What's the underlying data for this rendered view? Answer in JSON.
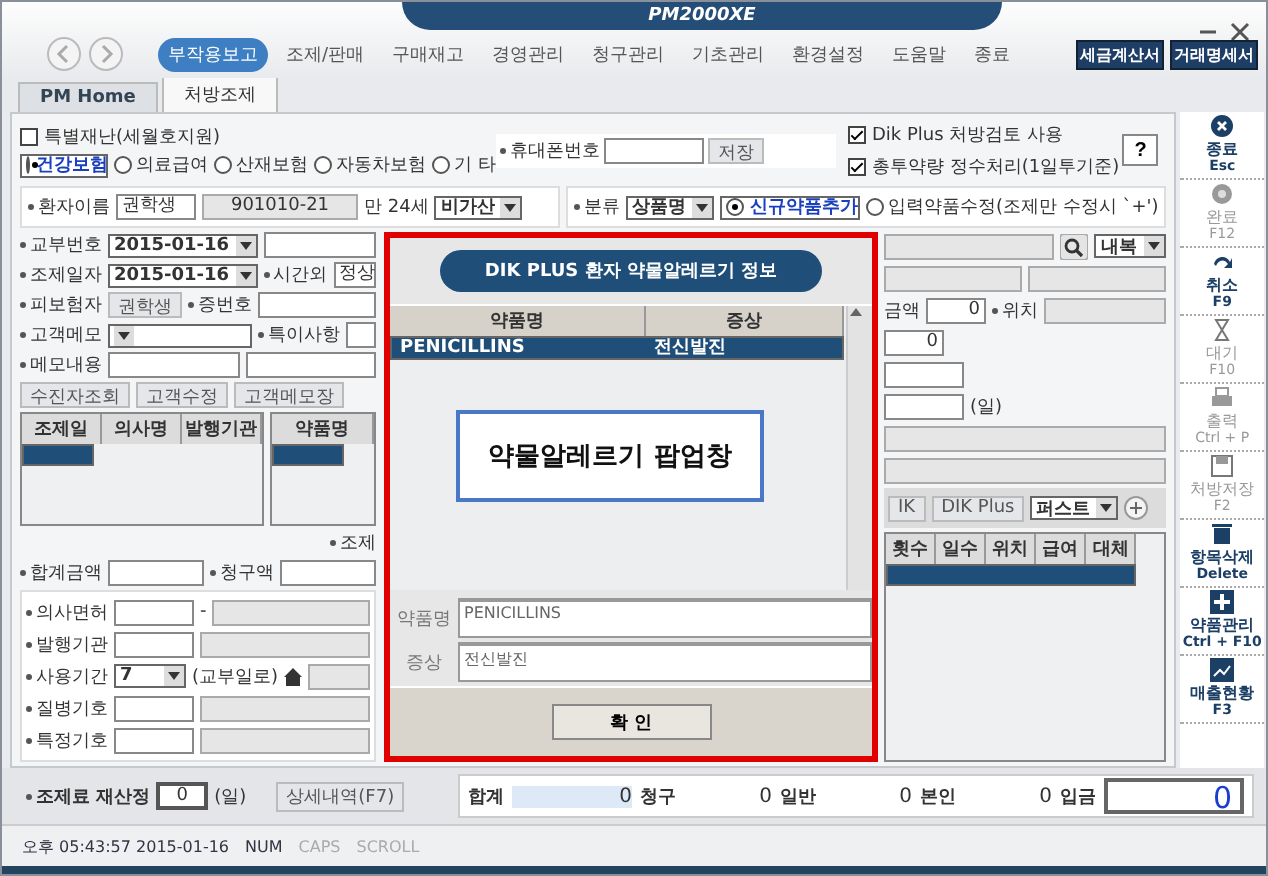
{
  "window": {
    "title": "PM2000XE"
  },
  "menu": [
    {
      "label": "부작용보고",
      "selected": true
    },
    {
      "label": "조제/판매",
      "selected": false
    },
    {
      "label": "구매재고",
      "selected": false
    },
    {
      "label": "경영관리",
      "selected": false
    },
    {
      "label": "청구관리",
      "selected": false
    },
    {
      "label": "기초관리",
      "selected": false
    },
    {
      "label": "환경설정",
      "selected": false
    },
    {
      "label": "도움말",
      "selected": false
    },
    {
      "label": "종료",
      "selected": false
    }
  ],
  "header_buttons": [
    "세금계산서",
    "거래명세서"
  ],
  "tabs": [
    {
      "label": "PM Home",
      "selected": false
    },
    {
      "label": "처방조제",
      "selected": true
    }
  ],
  "special_disaster": {
    "label": "특별재난(세월호지원)",
    "checked": false
  },
  "insurance_types": [
    {
      "label": "건강보험",
      "selected": true
    },
    {
      "label": "의료급여",
      "selected": false
    },
    {
      "label": "산재보험",
      "selected": false
    },
    {
      "label": "자동차보험",
      "selected": false
    },
    {
      "label": "기 타",
      "selected": false
    }
  ],
  "phone": {
    "label": "휴대폰번호",
    "save": "저장"
  },
  "options": [
    {
      "label": "Dik Plus 처방검토 사용",
      "checked": true
    },
    {
      "label": "총투약량 정수처리(1일투기준)",
      "checked": true
    }
  ],
  "help": "?",
  "patient_row": [
    {
      "kind": "label",
      "text": "환자이름"
    },
    {
      "kind": "box",
      "value": "권학생"
    },
    {
      "kind": "field",
      "value": "901010-21"
    },
    {
      "kind": "text",
      "text": "만 24세"
    },
    {
      "kind": "select",
      "value": "비가산"
    }
  ],
  "classify_row": [
    {
      "kind": "label",
      "text": "분류"
    },
    {
      "kind": "select",
      "value": "상품명"
    },
    {
      "kind": "radio",
      "text": "신규약품추가",
      "selected": true
    },
    {
      "kind": "radio",
      "text": "입력약품수정(조제만 수정시 `+')",
      "selected": false
    }
  ],
  "left_rows": [
    [
      {
        "kind": "label",
        "text": "교부번호"
      },
      {
        "kind": "select",
        "value": "2015-01-16"
      },
      {
        "kind": "field"
      }
    ],
    [
      {
        "kind": "label",
        "text": "조제일자"
      },
      {
        "kind": "select",
        "value": "2015-01-16"
      },
      {
        "kind": "label",
        "text": "시간외"
      },
      {
        "kind": "field",
        "value": "정상"
      }
    ],
    [
      {
        "kind": "label",
        "text": "피보험자"
      },
      {
        "kind": "button",
        "text": "권학생"
      },
      {
        "kind": "label",
        "text": "증번호"
      },
      {
        "kind": "field"
      }
    ],
    [
      {
        "kind": "label",
        "text": "고객메모"
      },
      {
        "kind": "select"
      },
      {
        "kind": "label",
        "text": "특이사항"
      },
      {
        "kind": "field"
      }
    ],
    [
      {
        "kind": "label",
        "text": "메모내용"
      },
      {
        "kind": "field"
      },
      {
        "kind": "field"
      }
    ],
    [
      {
        "kind": "button",
        "text": "수진자조회"
      },
      {
        "kind": "button",
        "text": "고객수정"
      },
      {
        "kind": "button",
        "text": "고객메모장"
      }
    ]
  ],
  "history_table": {
    "columns": [
      "조제일",
      "의사명",
      "발행기관"
    ],
    "rows": [
      {
        "selected": true
      }
    ]
  },
  "drug_table": {
    "columns": [
      "약품명"
    ],
    "rows": [
      {
        "selected": true
      }
    ]
  },
  "sum_rows": [
    [
      {
        "kind": "label",
        "text": "조제"
      }
    ],
    [
      {
        "kind": "label",
        "text": "합계금액"
      },
      {
        "kind": "field"
      },
      {
        "kind": "label",
        "text": "청구액"
      },
      {
        "kind": "field"
      }
    ]
  ],
  "doctor_rows": [
    [
      {
        "kind": "label",
        "text": "의사면허"
      },
      {
        "kind": "box"
      },
      {
        "kind": "text",
        "text": "-"
      },
      {
        "kind": "field"
      }
    ],
    [
      {
        "kind": "label",
        "text": "발행기관"
      },
      {
        "kind": "box"
      },
      {
        "kind": "field"
      }
    ],
    [
      {
        "kind": "label",
        "text": "사용기간"
      },
      {
        "kind": "select",
        "value": "7"
      },
      {
        "kind": "text",
        "text": "(교부일로)"
      },
      {
        "kind": "icon"
      },
      {
        "kind": "field"
      }
    ],
    [
      {
        "kind": "label",
        "text": "질병기호"
      },
      {
        "kind": "box"
      },
      {
        "kind": "field"
      }
    ],
    [
      {
        "kind": "label",
        "text": "특정기호"
      },
      {
        "kind": "box"
      },
      {
        "kind": "field"
      }
    ]
  ],
  "right_rows": [
    [
      {
        "kind": "field"
      },
      {
        "kind": "search"
      },
      {
        "kind": "select",
        "value": "내복"
      }
    ],
    [
      {
        "kind": "field"
      },
      {
        "kind": "field"
      }
    ],
    [
      {
        "kind": "text",
        "text": "금액"
      },
      {
        "kind": "number",
        "value": "0"
      },
      {
        "kind": "label",
        "text": "위치"
      },
      {
        "kind": "field"
      }
    ],
    [
      {
        "kind": "number",
        "value": "0"
      }
    ],
    [
      {
        "kind": "box"
      }
    ],
    [
      {
        "kind": "box"
      },
      {
        "kind": "text",
        "text": "(일)"
      }
    ],
    [
      {
        "kind": "field"
      }
    ],
    [
      {
        "kind": "field"
      }
    ],
    [
      {
        "kind": "button",
        "text": "IK"
      },
      {
        "kind": "button",
        "text": "DIK Plus"
      },
      {
        "kind": "select",
        "value": "퍼스트"
      },
      {
        "kind": "plus"
      }
    ]
  ],
  "rx_table": {
    "columns": [
      "횟수",
      "일수",
      "위치",
      "급여",
      "대체"
    ],
    "rows": [
      {
        "selected": true
      }
    ]
  },
  "popup": {
    "title": "DIK PLUS 환자 약물알레르기 정보",
    "columns": [
      "약품명",
      "증상"
    ],
    "rows": [
      {
        "cells": [
          "PENICILLINS",
          "전신발진"
        ],
        "selected": true
      }
    ],
    "note": "약물알레르기 팝업창",
    "details": [
      {
        "label": "약품명",
        "value": "PENICILLINS"
      },
      {
        "label": "증상",
        "value": "전신발진"
      }
    ],
    "confirm": "확 인"
  },
  "sidebar": [
    {
      "kind": "close",
      "label": "종료",
      "key": "Esc",
      "disabled": false
    },
    {
      "kind": "done",
      "label": "완료",
      "key": "F12",
      "disabled": true
    },
    {
      "kind": "undo",
      "label": "취소",
      "key": "F9",
      "disabled": false
    },
    {
      "kind": "wait",
      "label": "대기",
      "key": "F10",
      "disabled": true
    },
    {
      "kind": "print",
      "label": "출력",
      "key": "Ctrl + P",
      "disabled": true
    },
    {
      "kind": "save",
      "label": "처방저장",
      "key": "F2",
      "disabled": true
    },
    {
      "kind": "delete",
      "label": "항목삭제",
      "key": "Delete",
      "disabled": false
    },
    {
      "kind": "add",
      "label": "약품관리",
      "key": "Ctrl + F10",
      "disabled": false
    },
    {
      "kind": "chart",
      "label": "매출현황",
      "key": "F3",
      "disabled": false
    }
  ],
  "recalc": {
    "label": "조제료 재산정",
    "value": "0",
    "unit": "(일)",
    "detail": "상세내역(F7)"
  },
  "totals": [
    {
      "kind": "amount",
      "label": "합계",
      "value": "0"
    },
    {
      "kind": "amount",
      "label": "청구",
      "value": "0"
    },
    {
      "kind": "amount",
      "label": "일반",
      "value": "0"
    },
    {
      "kind": "amount",
      "label": "본인",
      "value": "0"
    },
    {
      "kind": "payment",
      "label": "입금",
      "value": "0"
    }
  ],
  "status_bar": [
    {
      "text": "오후 05:43:57 2015-01-16",
      "on": true
    },
    {
      "text": "NUM",
      "on": true
    },
    {
      "text": "CAPS",
      "on": false
    },
    {
      "text": "SCROLL",
      "on": false
    }
  ]
}
